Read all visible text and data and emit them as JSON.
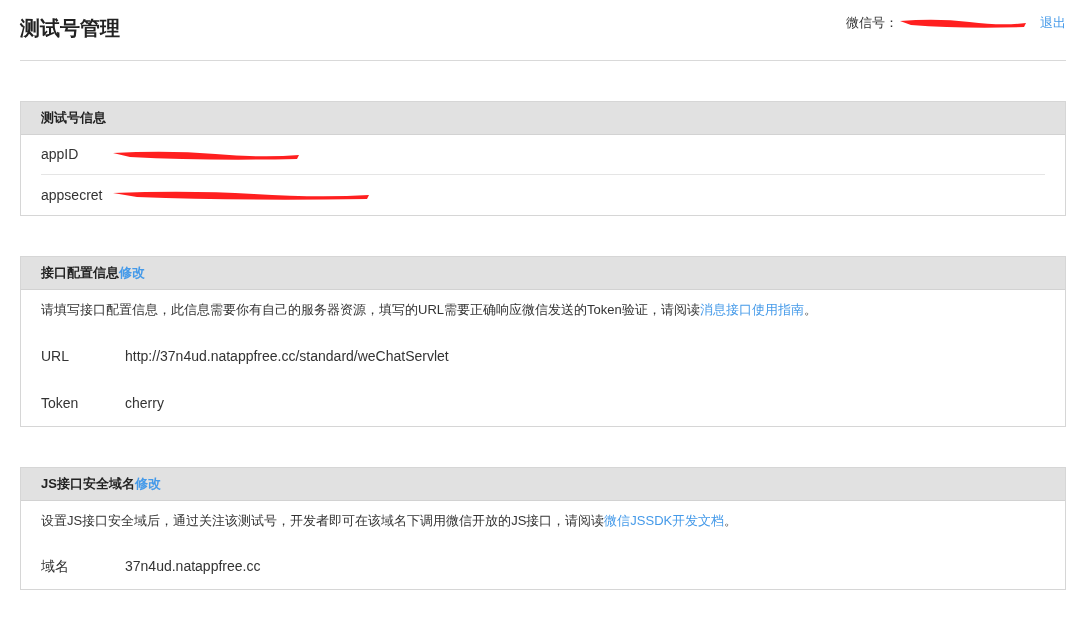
{
  "header": {
    "title": "测试号管理",
    "wechat_label": "微信号：",
    "logout": "退出"
  },
  "account_panel": {
    "title": "测试号信息",
    "rows": [
      {
        "label": "appID"
      },
      {
        "label": "appsecret"
      }
    ]
  },
  "interface_panel": {
    "title": "接口配置信息",
    "edit": "修改",
    "description": "请填写接口配置信息，此信息需要你有自己的服务器资源，填写的URL需要正确响应微信发送的Token验证，请阅读",
    "link": "消息接口使用指南",
    "end": "。",
    "fields": [
      {
        "label": "URL",
        "value": "http://37n4ud.natappfree.cc/standard/weChatServlet"
      },
      {
        "label": "Token",
        "value": "cherry"
      }
    ]
  },
  "js_panel": {
    "title": "JS接口安全域名",
    "edit": "修改",
    "description": "设置JS接口安全域后，通过关注该测试号，开发者即可在该域名下调用微信开放的JS接口，请阅读",
    "link": "微信JSSDK开发文档",
    "end": "。",
    "fields": [
      {
        "label": "域名",
        "value": "37n4ud.natappfree.cc"
      }
    ]
  }
}
